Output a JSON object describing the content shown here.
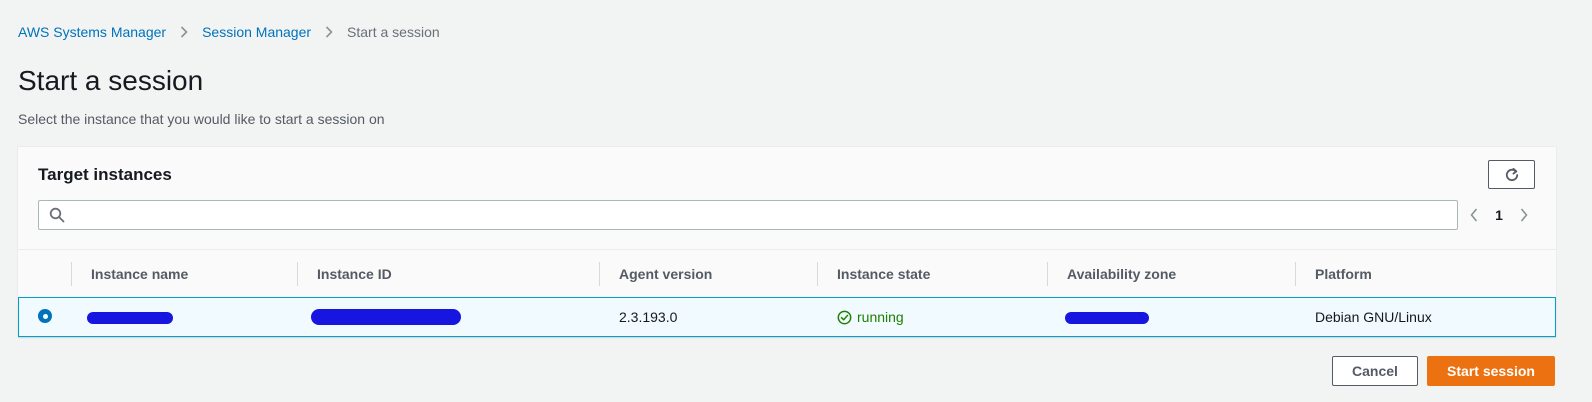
{
  "breadcrumb": {
    "items": [
      "AWS Systems Manager",
      "Session Manager"
    ],
    "current": "Start a session"
  },
  "page": {
    "title": "Start a session",
    "description": "Select the instance that you would like to start a session on"
  },
  "target_instances": {
    "title": "Target instances",
    "refresh_icon": "refresh-icon",
    "search": {
      "placeholder": "",
      "value": ""
    },
    "pagination": {
      "current_page": "1"
    },
    "columns": [
      "Instance name",
      "Instance ID",
      "Agent version",
      "Instance state",
      "Availability zone",
      "Platform"
    ],
    "rows": [
      {
        "selected": true,
        "instance_name": "",
        "instance_id": "",
        "agent_version": "2.3.193.0",
        "instance_state": "running",
        "availability_zone": "",
        "platform": "Debian GNU/Linux"
      }
    ]
  },
  "actions": {
    "cancel_label": "Cancel",
    "start_label": "Start session"
  },
  "colors": {
    "link": "#0073bb",
    "primary_button": "#ec7211",
    "running": "#1d8102",
    "selected_row_border": "#00a1c9",
    "redaction": "#1616e0"
  }
}
